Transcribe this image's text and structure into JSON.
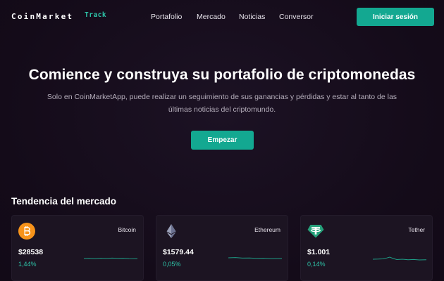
{
  "header": {
    "logo_main": "CoinMarket",
    "logo_accent": "Track",
    "nav": [
      "Portafolio",
      "Mercado",
      "Noticias",
      "Conversor"
    ],
    "login_label": "Iniciar sesión"
  },
  "hero": {
    "title": "Comience y construya su portafolio de criptomonedas",
    "subtitle": "Solo en CoinMarketApp, puede realizar un seguimiento de sus ganancias y pérdidas y estar al tanto de las últimas noticias del criptomundo.",
    "cta_label": "Empezar"
  },
  "market": {
    "title": "Tendencia del mercado",
    "coins": [
      {
        "name": "Bitcoin",
        "price": "$28538",
        "change": "1,44%",
        "icon": "bitcoin-icon",
        "color": "#f7931a"
      },
      {
        "name": "Ethereum",
        "price": "$1579.44",
        "change": "0,05%",
        "icon": "ethereum-icon",
        "color": "#627eea"
      },
      {
        "name": "Tether",
        "price": "$1.001",
        "change": "0,14%",
        "icon": "tether-icon",
        "color": "#26a17b"
      }
    ]
  },
  "colors": {
    "accent": "#13a891",
    "positive": "#2ec4a8",
    "background": "#150c1a",
    "card": "#1c1422"
  }
}
